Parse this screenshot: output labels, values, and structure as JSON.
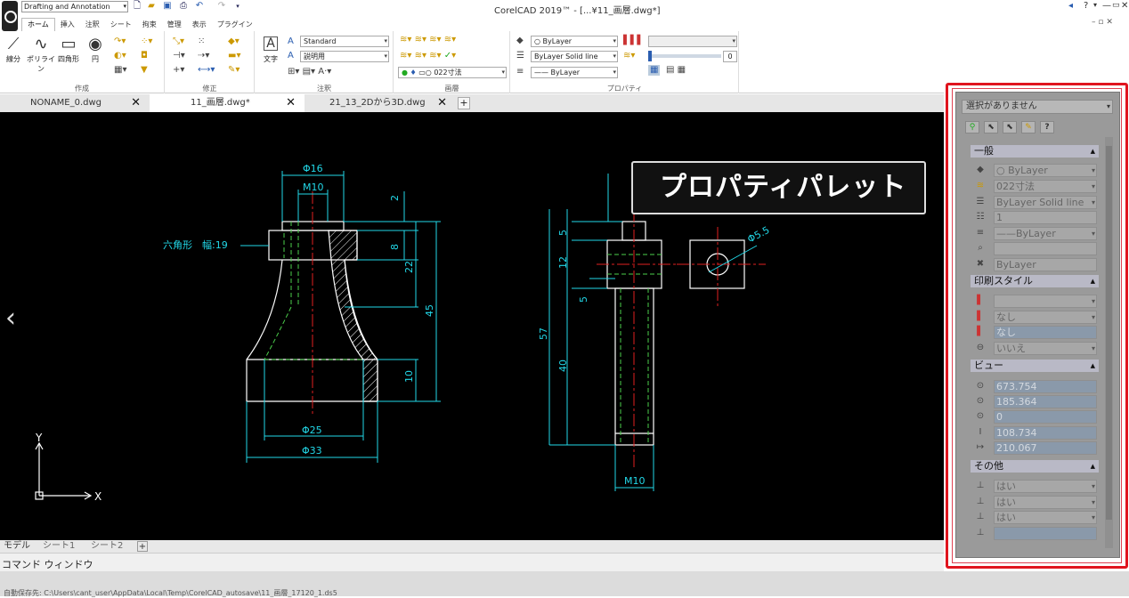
{
  "titlebar": {
    "workspace": "Drafting and Annotation",
    "app_title": "CorelCAD 2019™ - [...¥11_画層.dwg*]",
    "right_icons": [
      "◂",
      "?",
      "▾",
      "—",
      "▭",
      "✕"
    ]
  },
  "ribbon_tabs": [
    "ホーム",
    "挿入",
    "注釈",
    "シート",
    "拘束",
    "管理",
    "表示",
    "プラグイン"
  ],
  "ribbon": {
    "draw": {
      "label": "作成",
      "tools": [
        "線分",
        "ポリライン",
        "四角形",
        "円"
      ]
    },
    "modify": {
      "label": "修正"
    },
    "annotation": {
      "label": "注釈",
      "text_tool": "文字",
      "text_style": "Standard",
      "dim_style": "説明用"
    },
    "layers": {
      "label": "画層",
      "current_layer": "022寸法"
    },
    "properties": {
      "label": "プロパティ",
      "color": "ByLayer",
      "linetype": "ByLayer    Solid line",
      "lineweight": "—— ByLayer",
      "transparency": "0"
    }
  },
  "doc_tabs": [
    {
      "label": "NONAME_0.dwg",
      "active": false
    },
    {
      "label": "11_画層.dwg*",
      "active": true
    },
    {
      "label": "21_13_2Dから3D.dwg",
      "active": false
    }
  ],
  "drawing": {
    "left_labels": {
      "hex": "六角形　幅:19",
      "d16": "Φ16",
      "m10_top": "M10",
      "d25": "Φ25",
      "d33": "Φ33",
      "v2": "2",
      "v8": "8",
      "v22": "22",
      "v45": "45",
      "v10": "10"
    },
    "right_labels": {
      "v5a": "5",
      "v12": "12",
      "v5b": "5",
      "v57": "57",
      "v40": "40",
      "m10_bottom": "M10",
      "d55": "Φ5.5"
    },
    "ucs_x": "X",
    "ucs_y": "Y"
  },
  "callout": "プロパティパレット",
  "palette": {
    "selection": "選択がありません",
    "toolbar_icons": [
      "quick-select-icon",
      "select-objects-icon",
      "pickadd-icon",
      "toggle-icon",
      "help-icon"
    ],
    "help": "?",
    "sections": {
      "general": {
        "title": "一般",
        "rows": [
          {
            "icon": "color-icon",
            "value": "○ ByLayer",
            "dropdown": true
          },
          {
            "icon": "layer-icon",
            "value": "022寸法",
            "dropdown": true
          },
          {
            "icon": "linetype-icon",
            "value": "ByLayer    Solid line",
            "dropdown": true
          },
          {
            "icon": "ltscale-icon",
            "value": "1",
            "dropdown": false
          },
          {
            "icon": "lineweight-icon",
            "value": "——ByLayer",
            "dropdown": true
          },
          {
            "icon": "hyperlink-icon",
            "value": "",
            "dropdown": false
          },
          {
            "icon": "transparency-icon",
            "value": "ByLayer",
            "dropdown": false
          }
        ]
      },
      "print_style": {
        "title": "印刷スタイル",
        "rows": [
          {
            "icon": "print-style-icon",
            "value": "",
            "dropdown": true
          },
          {
            "icon": "print-table-icon",
            "value": "なし",
            "dropdown": true
          },
          {
            "icon": "print-attach-icon",
            "value": "なし",
            "dropdown": false
          },
          {
            "icon": "print-available-icon",
            "value": "いいえ",
            "dropdown": true
          }
        ]
      },
      "view": {
        "title": "ビュー",
        "rows": [
          {
            "icon": "center-x-icon",
            "value": "673.754"
          },
          {
            "icon": "center-y-icon",
            "value": "185.364"
          },
          {
            "icon": "center-z-icon",
            "value": "0"
          },
          {
            "icon": "height-icon",
            "value": "108.734"
          },
          {
            "icon": "width-icon",
            "value": "210.067"
          }
        ]
      },
      "misc": {
        "title": "その他",
        "rows": [
          {
            "icon": "ucs-icon-on-icon",
            "value": "はい"
          },
          {
            "icon": "ucs-origin-icon",
            "value": "はい"
          },
          {
            "icon": "ucs-per-viewport-icon",
            "value": "はい"
          },
          {
            "icon": "ucs-name-icon",
            "value": ""
          }
        ]
      }
    }
  },
  "sheet_tabs": [
    "モデル",
    "シート1",
    "シート2"
  ],
  "command_window": "コマンド ウィンドウ",
  "status_text": "自動保存先: C:\\Users\\cant_user\\AppData\\Local\\Temp\\CorelCAD_autosave\\11_画層_17120_1.ds5"
}
